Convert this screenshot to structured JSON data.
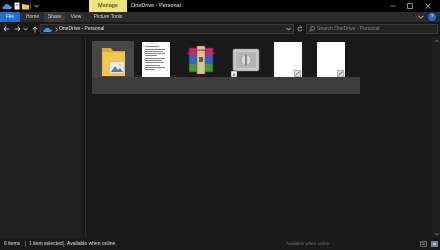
{
  "window": {
    "title": "OneDrive - Personal",
    "context_tab": "Manage"
  },
  "ribbon": {
    "tabs": [
      {
        "label": "File",
        "active": false,
        "accent": "#1b6fd0"
      },
      {
        "label": "Home",
        "active": false
      },
      {
        "label": "Share",
        "active": true
      },
      {
        "label": "View",
        "active": false
      },
      {
        "label": "Picture Tools",
        "active": false
      }
    ],
    "help_label": "?"
  },
  "address_bar": {
    "location_icon": "onedrive-cloud-icon",
    "path": [
      "OneDrive - Personal"
    ]
  },
  "search": {
    "placeholder": "Search OneDrive - Personal"
  },
  "files": [
    {
      "type": "folder",
      "icon": "folder-icon",
      "selected": true
    },
    {
      "type": "document",
      "icon": "document-icon",
      "selected": false
    },
    {
      "type": "archive",
      "icon": "winrar-archive-icon",
      "selected": false
    },
    {
      "type": "installer",
      "icon": "installer-icon",
      "selected": false
    },
    {
      "type": "file",
      "icon": "blank-file-icon",
      "selected": false
    },
    {
      "type": "file",
      "icon": "blank-file-icon",
      "selected": false
    }
  ],
  "status": {
    "item_count": "6 items",
    "selection": "1 item selected",
    "availability": "Available when online",
    "online_status": "Available when online"
  },
  "colors": {
    "accent": "#1b6fd0",
    "manage_tab": "#f0e57a",
    "background": "#191919"
  }
}
